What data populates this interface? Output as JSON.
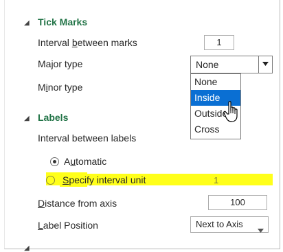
{
  "tick_marks": {
    "title": "Tick Marks",
    "interval_label": {
      "pre": "Interval ",
      "ul": "b",
      "post": "etween marks"
    },
    "interval_value": "1",
    "major_label": "Major type",
    "major_value": "None",
    "minor_label": {
      "pre": "M",
      "ul": "i",
      "post": "nor type"
    }
  },
  "dropdown": {
    "options": [
      "None",
      "Inside",
      "Outside",
      "Cross"
    ],
    "selected_index": 1
  },
  "labels": {
    "title": "Labels",
    "interval_label": "Interval between labels",
    "automatic": {
      "pre": "A",
      "ul": "u",
      "post": "tomatic",
      "checked": true
    },
    "specify": {
      "ul": "S",
      "post": "pecify interval unit",
      "checked": false
    },
    "specify_value": "1",
    "distance_label": {
      "ul": "D",
      "post": "istance from axis"
    },
    "distance_value": "100",
    "position_label": {
      "ul": "L",
      "post": "abel Position"
    },
    "position_value": "Next to Axis"
  },
  "colors": {
    "section_title": "#217346",
    "selection": "#0a6fd3",
    "highlight": "#ffff1a"
  },
  "icons": [
    "collapse-triangle-icon",
    "dropdown-arrow-icon",
    "hand-cursor-icon"
  ]
}
